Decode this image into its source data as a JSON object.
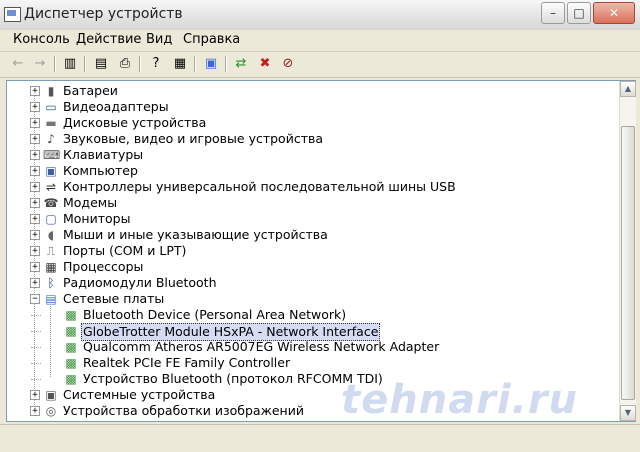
{
  "window": {
    "title": "Диспетчер устройств",
    "controls": {
      "minimize": "–",
      "maximize": "□",
      "close": "✕"
    }
  },
  "menu": [
    "Консоль",
    "Действие",
    "Вид",
    "Справка"
  ],
  "toolbar": {
    "icons": [
      "back-arrow-icon",
      "forward-arrow-icon",
      "show-hide-tree-icon",
      "properties-icon",
      "print-icon",
      "help-icon",
      "console-tree-icon",
      "scan-hardware-icon",
      "update-driver-icon",
      "uninstall-device-icon",
      "disable-device-icon"
    ]
  },
  "tree": {
    "items": [
      {
        "label": "Батареи",
        "expander": "+",
        "icon": "battery-icon"
      },
      {
        "label": "Видеоадаптеры",
        "expander": "+",
        "icon": "display-adapter-icon"
      },
      {
        "label": "Дисковые устройства",
        "expander": "+",
        "icon": "disk-drive-icon"
      },
      {
        "label": "Звуковые, видео и игровые устройства",
        "expander": "+",
        "icon": "sound-device-icon"
      },
      {
        "label": "Клавиатуры",
        "expander": "+",
        "icon": "keyboard-icon"
      },
      {
        "label": "Компьютер",
        "expander": "+",
        "icon": "computer-icon"
      },
      {
        "label": "Контроллеры универсальной последовательной шины USB",
        "expander": "+",
        "icon": "usb-icon"
      },
      {
        "label": "Модемы",
        "expander": "+",
        "icon": "modem-icon"
      },
      {
        "label": "Мониторы",
        "expander": "+",
        "icon": "monitor-icon"
      },
      {
        "label": "Мыши и иные указывающие устройства",
        "expander": "+",
        "icon": "mouse-icon"
      },
      {
        "label": "Порты (COM и LPT)",
        "expander": "+",
        "icon": "port-icon"
      },
      {
        "label": "Процессоры",
        "expander": "+",
        "icon": "processor-icon"
      },
      {
        "label": "Радиомодули Bluetooth",
        "expander": "+",
        "icon": "bluetooth-icon"
      },
      {
        "label": "Сетевые платы",
        "expander": "−",
        "icon": "network-adapter-icon"
      },
      {
        "label": "Bluetooth Device (Personal Area Network)",
        "child": true,
        "icon": "network-card-icon"
      },
      {
        "label": "GlobeTrotter Module HSxPA - Network Interface",
        "child": true,
        "selected": true,
        "icon": "network-card-icon"
      },
      {
        "label": "Qualcomm Atheros AR5007EG Wireless Network Adapter",
        "child": true,
        "icon": "network-card-icon"
      },
      {
        "label": "Realtek PCIe FE Family Controller",
        "child": true,
        "icon": "network-card-icon"
      },
      {
        "label": "Устройство Bluetooth (протокол RFCOMM TDI)",
        "child": true,
        "icon": "network-card-icon"
      },
      {
        "label": "Системные устройства",
        "expander": "+",
        "icon": "system-device-icon"
      },
      {
        "label": "Устройства обработки изображений",
        "expander": "+",
        "icon": "imaging-device-icon"
      }
    ]
  },
  "watermark": "tehnari.ru",
  "colors": {
    "selection": "#d5dcf3",
    "pane_border": "#7f9db9",
    "network_card": "#2f8f2f"
  }
}
